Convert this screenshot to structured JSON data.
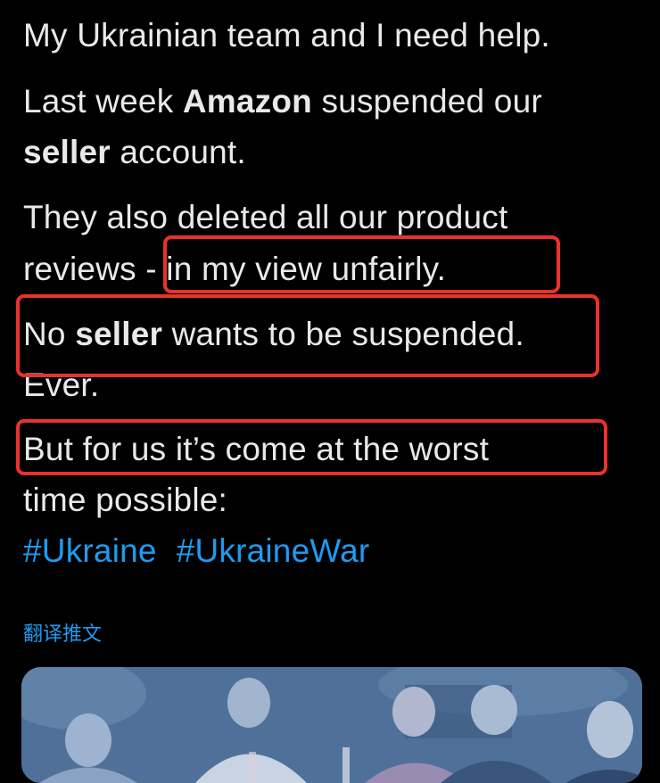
{
  "tweet": {
    "lines": [
      {
        "text": "My Ukrainian team and I need help."
      },
      {
        "pre": "Last week ",
        "bold": "Amazon",
        "post": " suspended our"
      },
      {
        "bold": "seller",
        "post": " account."
      },
      {
        "text": "They also deleted all our product"
      },
      {
        "text": "reviews - in my view unfairly."
      },
      {
        "pre": "No ",
        "bold": "seller",
        "post": " wants to be suspended."
      },
      {
        "text": "Ever."
      },
      {
        "text": "But for us it’s come at the worst"
      },
      {
        "text": "time possible:"
      }
    ],
    "hashtags": [
      "#Ukraine",
      "#UkraineWar"
    ],
    "translate_label": "翻译推文"
  },
  "colors": {
    "background": "#000000",
    "text": "#e7e9ea",
    "link": "#1d9bf0",
    "highlight_box": "#e8322e"
  },
  "media": {
    "icon": "group-photo-image"
  }
}
